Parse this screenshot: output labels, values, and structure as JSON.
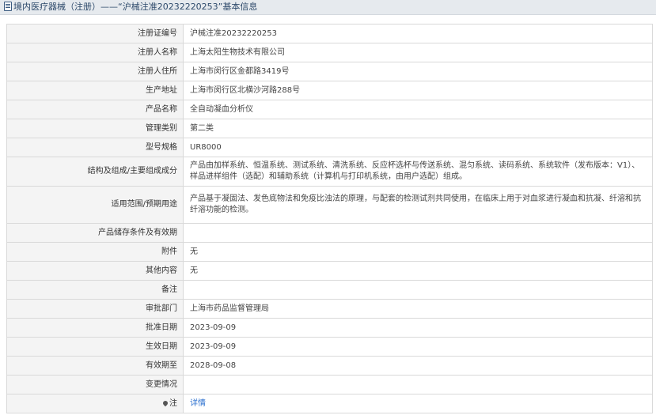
{
  "header": {
    "title": "境内医疗器械（注册）——“沪械注准20232220253”基本信息"
  },
  "rows": [
    {
      "label": "注册证编号",
      "value": "沪械注准20232220253"
    },
    {
      "label": "注册人名称",
      "value": "上海太阳生物技术有限公司"
    },
    {
      "label": "注册人住所",
      "value": "上海市闵行区金都路3419号"
    },
    {
      "label": "生产地址",
      "value": "上海市闵行区北横沙河路288号"
    },
    {
      "label": "产品名称",
      "value": "全自动凝血分析仪"
    },
    {
      "label": "管理类别",
      "value": "第二类"
    },
    {
      "label": "型号规格",
      "value": "UR8000"
    },
    {
      "label": "结构及组成/主要组成成分",
      "value": "产品由加样系统、恒温系统、测试系统、清洗系统、反应杯选杯与传送系统、混匀系统、读码系统、系统软件（发布版本：V1）、样品进样组件（选配）和辅助系统（计算机与打印机系统，由用户选配）组成。"
    },
    {
      "label": "适用范围/预期用途",
      "value": "产品基于凝固法、发色底物法和免疫比浊法的原理，与配套的检测试剂共同使用，在临床上用于对血浆进行凝血和抗凝、纤溶和抗纤溶功能的检测。"
    },
    {
      "label": "产品储存条件及有效期",
      "value": ""
    },
    {
      "label": "附件",
      "value": "无"
    },
    {
      "label": "其他内容",
      "value": "无"
    },
    {
      "label": "备注",
      "value": ""
    },
    {
      "label": "审批部门",
      "value": "上海市药品监督管理局"
    },
    {
      "label": "批准日期",
      "value": "2023-09-09"
    },
    {
      "label": "生效日期",
      "value": "2023-09-09"
    },
    {
      "label": "有效期至",
      "value": "2028-09-08"
    },
    {
      "label": "变更情况",
      "value": ""
    }
  ],
  "note": {
    "label": "注",
    "link_text": "详情"
  }
}
